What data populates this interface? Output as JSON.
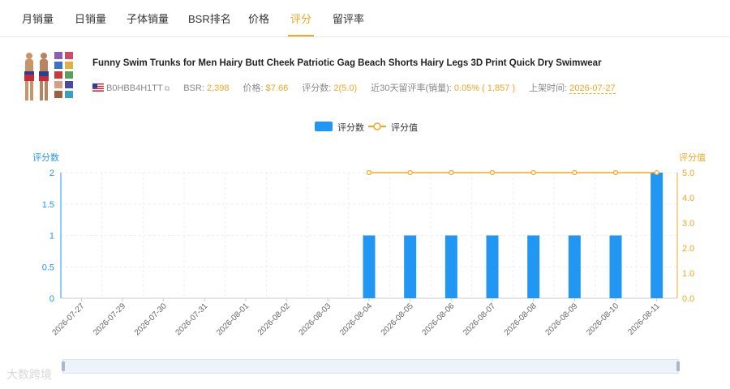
{
  "tabs": [
    {
      "label": "月销量",
      "active": false
    },
    {
      "label": "日销量",
      "active": false
    },
    {
      "label": "子体销量",
      "active": false
    },
    {
      "label": "BSR排名",
      "active": false
    },
    {
      "label": "价格",
      "active": false
    },
    {
      "label": "评分",
      "active": true
    },
    {
      "label": "留评率",
      "active": false
    }
  ],
  "product": {
    "title": "Funny Swim Trunks for Men Hairy Butt Cheek Patriotic Gag Beach Shorts Hairy Legs 3D Print Quick Dry Swimwear",
    "asin": "B0HBB4H1TT",
    "bsr_label": "BSR:",
    "bsr_value": "2,398",
    "price_label": "价格:",
    "price_value": "$7.66",
    "rating_count_label": "评分数:",
    "rating_count_value": "2(5.0)",
    "review_rate_label": "近30天留评率(销量):",
    "review_rate_value": "0.05% ( 1,857 )",
    "launch_label": "上架时间:",
    "launch_value": "2026-07-27"
  },
  "watermark": "大数跨境",
  "colors": {
    "accent": "#f5a623",
    "bar": "#2196f3",
    "line": "#f5a623"
  },
  "chart_data": {
    "type": "bar",
    "categories": [
      "2026-07-27",
      "2026-07-29",
      "2026-07-30",
      "2026-07-31",
      "2026-08-01",
      "2026-08-02",
      "2026-08-03",
      "2026-08-04",
      "2026-08-05",
      "2026-08-06",
      "2026-08-07",
      "2026-08-08",
      "2026-08-09",
      "2026-08-10",
      "2026-08-11"
    ],
    "series": [
      {
        "name": "评分数",
        "type": "bar",
        "axis": "left",
        "values": [
          null,
          null,
          null,
          null,
          null,
          null,
          null,
          1,
          1,
          1,
          1,
          1,
          1,
          1,
          2
        ]
      },
      {
        "name": "评分值",
        "type": "line",
        "axis": "right",
        "values": [
          null,
          null,
          null,
          null,
          null,
          null,
          null,
          5.0,
          5.0,
          5.0,
          5.0,
          5.0,
          5.0,
          5.0,
          5.0
        ]
      }
    ],
    "y_left": {
      "label": "评分数",
      "min": 0,
      "max": 2,
      "ticks": [
        "0",
        "0.5",
        "1",
        "1.5",
        "2"
      ]
    },
    "y_right": {
      "label": "评分值",
      "min": 0,
      "max": 5,
      "ticks": [
        "0.0",
        "1.0",
        "2.0",
        "3.0",
        "4.0",
        "5.0"
      ]
    },
    "grid": true,
    "legend": "top-center"
  }
}
